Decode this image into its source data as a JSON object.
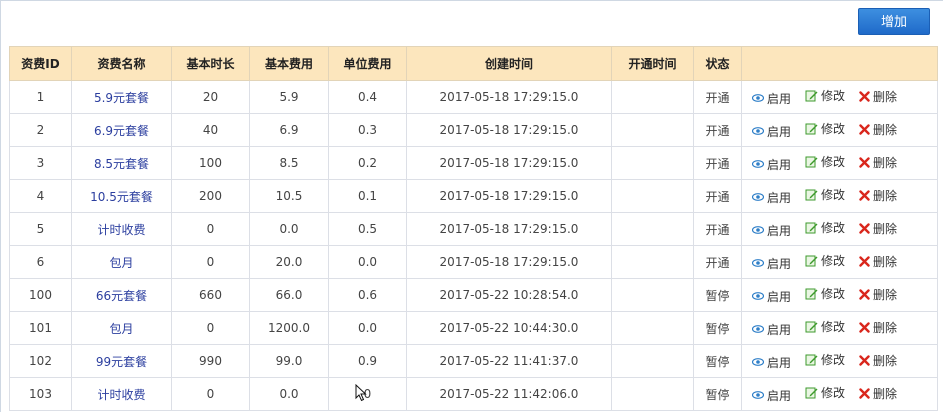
{
  "toolbar": {
    "add_label": "增加"
  },
  "table": {
    "headers": [
      "资费ID",
      "资费名称",
      "基本时长",
      "基本费用",
      "单位费用",
      "创建时间",
      "开通时间",
      "状态",
      ""
    ],
    "ops": {
      "enable": "启用",
      "edit": "修改",
      "delete": "删除"
    },
    "rows": [
      {
        "id": "1",
        "name": "5.9元套餐",
        "duration": "20",
        "base_fee": "5.9",
        "unit_fee": "0.4",
        "created": "2017-05-18 17:29:15.0",
        "opened": "",
        "status": "开通"
      },
      {
        "id": "2",
        "name": "6.9元套餐",
        "duration": "40",
        "base_fee": "6.9",
        "unit_fee": "0.3",
        "created": "2017-05-18 17:29:15.0",
        "opened": "",
        "status": "开通"
      },
      {
        "id": "3",
        "name": "8.5元套餐",
        "duration": "100",
        "base_fee": "8.5",
        "unit_fee": "0.2",
        "created": "2017-05-18 17:29:15.0",
        "opened": "",
        "status": "开通"
      },
      {
        "id": "4",
        "name": "10.5元套餐",
        "duration": "200",
        "base_fee": "10.5",
        "unit_fee": "0.1",
        "created": "2017-05-18 17:29:15.0",
        "opened": "",
        "status": "开通"
      },
      {
        "id": "5",
        "name": "计时收费",
        "duration": "0",
        "base_fee": "0.0",
        "unit_fee": "0.5",
        "created": "2017-05-18 17:29:15.0",
        "opened": "",
        "status": "开通"
      },
      {
        "id": "6",
        "name": "包月",
        "duration": "0",
        "base_fee": "20.0",
        "unit_fee": "0.0",
        "created": "2017-05-18 17:29:15.0",
        "opened": "",
        "status": "开通"
      },
      {
        "id": "100",
        "name": "66元套餐",
        "duration": "660",
        "base_fee": "66.0",
        "unit_fee": "0.6",
        "created": "2017-05-22 10:28:54.0",
        "opened": "",
        "status": "暂停"
      },
      {
        "id": "101",
        "name": "包月",
        "duration": "0",
        "base_fee": "1200.0",
        "unit_fee": "0.0",
        "created": "2017-05-22 10:44:30.0",
        "opened": "",
        "status": "暂停"
      },
      {
        "id": "102",
        "name": "99元套餐",
        "duration": "990",
        "base_fee": "99.0",
        "unit_fee": "0.9",
        "created": "2017-05-22 11:41:37.0",
        "opened": "",
        "status": "暂停"
      },
      {
        "id": "103",
        "name": "计时收费",
        "duration": "0",
        "base_fee": "0.0",
        "unit_fee": "0",
        "created": "2017-05-22 11:42:06.0",
        "opened": "",
        "status": "暂停"
      }
    ]
  },
  "colors": {
    "header_bg": "#fce6bd",
    "button_bg": "#2a78d6",
    "link": "#2b3e9f",
    "delete_x": "#d9261c",
    "edit_green": "#3d9a2c",
    "eye_blue": "#2f7fc8"
  }
}
